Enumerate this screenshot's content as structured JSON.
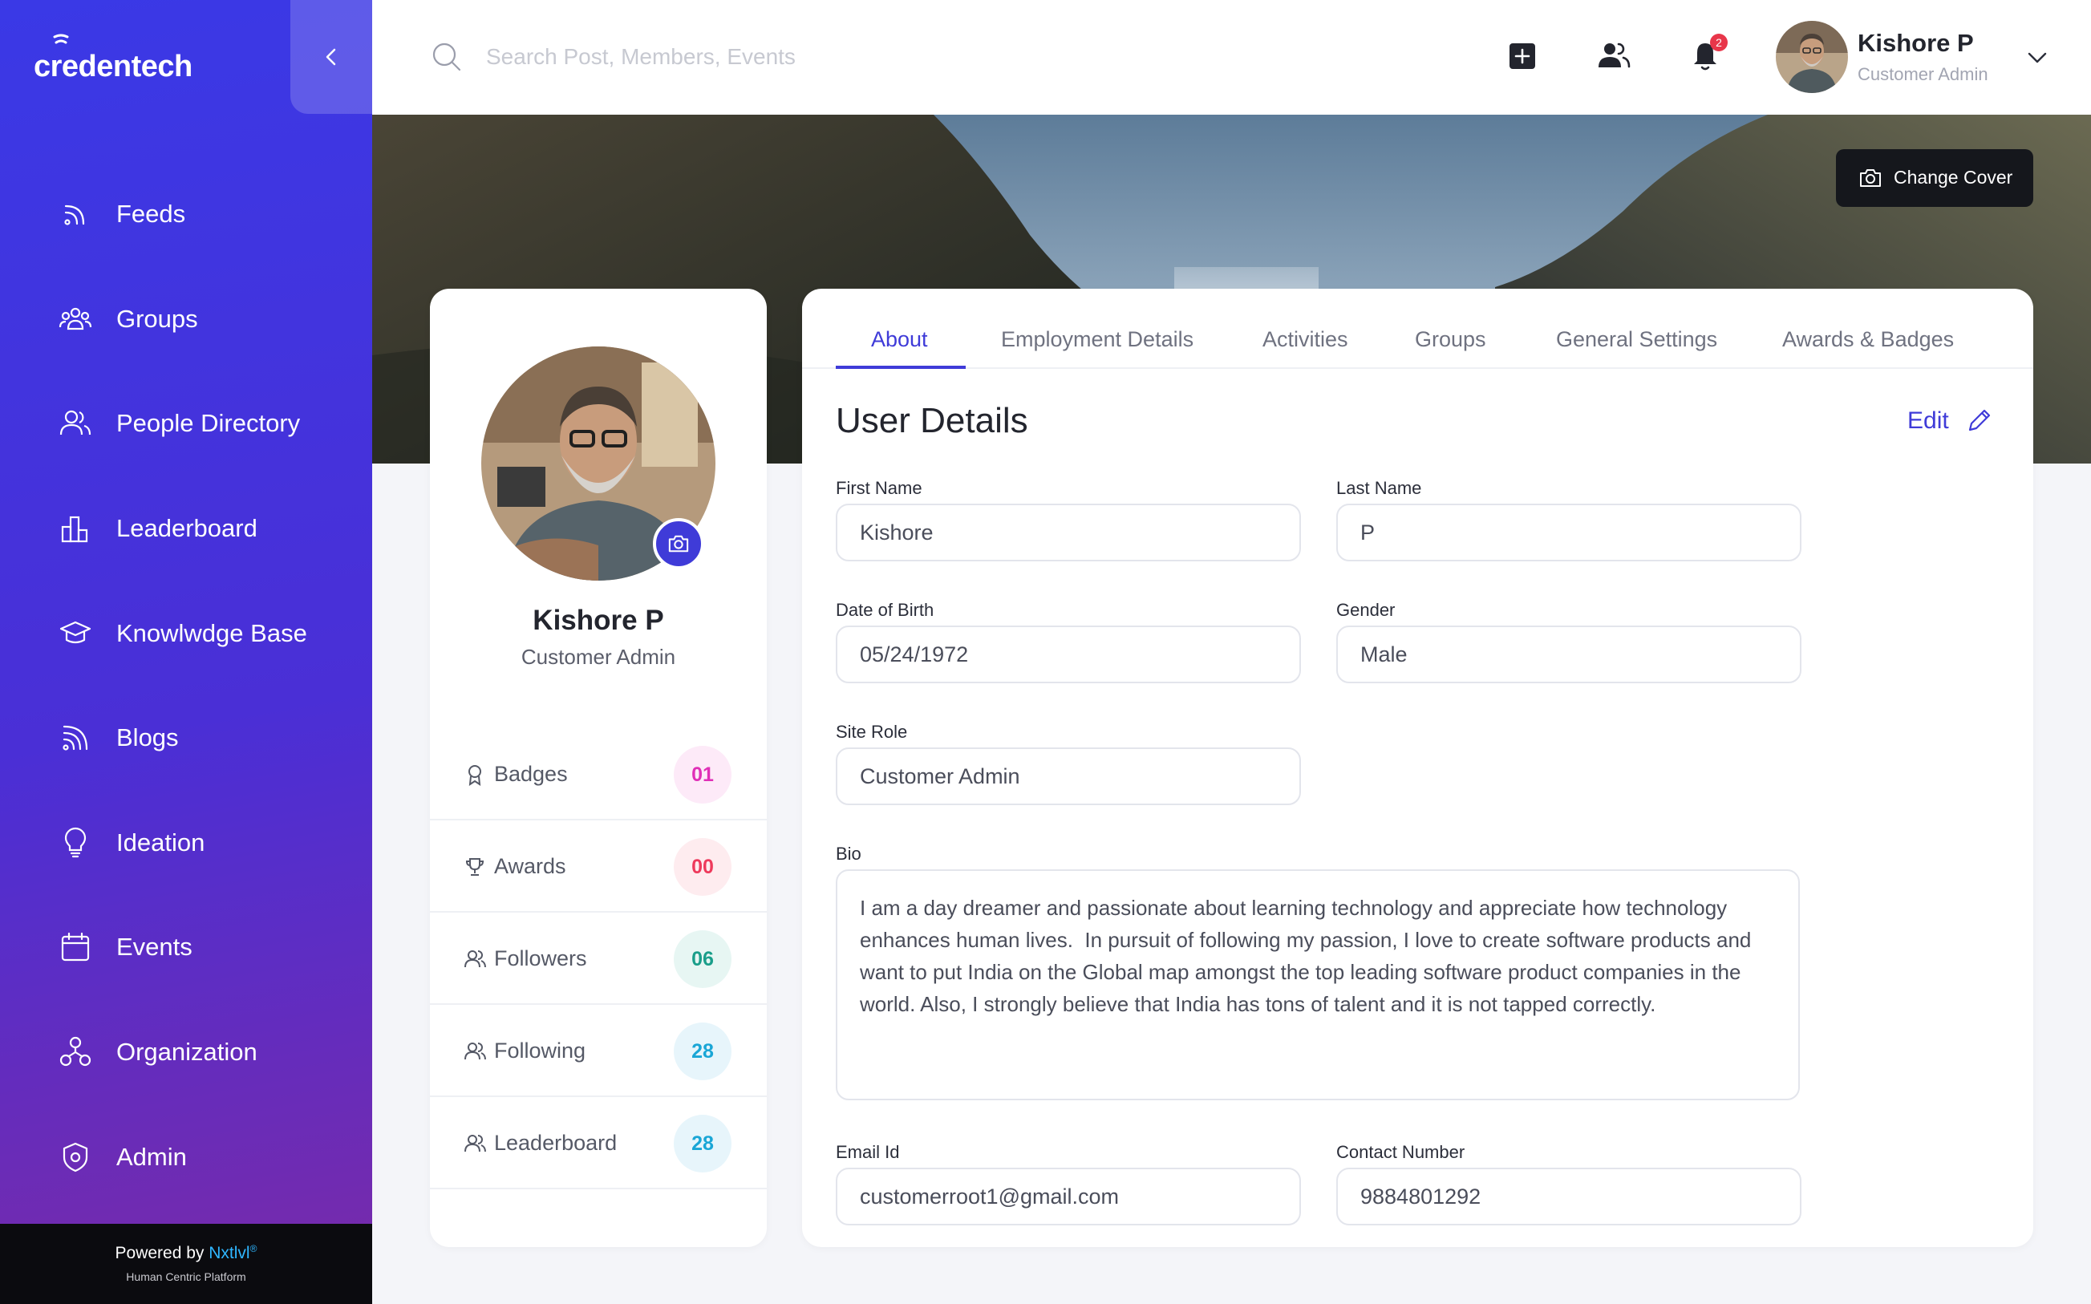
{
  "brand": {
    "logo_text": "credentech",
    "accent": "#3f3bd8"
  },
  "sidebar": {
    "items": [
      {
        "label": "Feeds",
        "icon": "rss-icon"
      },
      {
        "label": "Groups",
        "icon": "group-icon"
      },
      {
        "label": "People Directory",
        "icon": "people-icon"
      },
      {
        "label": "Leaderboard",
        "icon": "leaderboard-icon"
      },
      {
        "label": "Knowlwdge Base",
        "icon": "graduation-cap-icon"
      },
      {
        "label": "Blogs",
        "icon": "blog-icon"
      },
      {
        "label": "Ideation",
        "icon": "lightbulb-icon"
      },
      {
        "label": "Events",
        "icon": "calendar-icon"
      },
      {
        "label": "Organization",
        "icon": "org-chart-icon"
      },
      {
        "label": "Admin",
        "icon": "admin-shield-icon"
      }
    ],
    "powered_prefix": "Powered by ",
    "powered_brand": "Nxtlvl",
    "powered_mark": "®",
    "powered_tagline": "Human Centric Platform"
  },
  "topbar": {
    "search_placeholder": "Search Post, Members, Events",
    "notification_count": "2",
    "user_name": "Kishore P",
    "user_role": "Customer Admin"
  },
  "cover": {
    "change_cover_label": "Change Cover"
  },
  "profile": {
    "name": "Kishore P",
    "role": "Customer Admin",
    "stats": [
      {
        "label": "Badges",
        "value": "01",
        "color": "#e02fb7",
        "bg": "#fdeaf8",
        "icon": "badge-icon"
      },
      {
        "label": "Awards",
        "value": "00",
        "color": "#ee3a5c",
        "bg": "#feecef",
        "icon": "trophy-icon"
      },
      {
        "label": "Followers",
        "value": "06",
        "color": "#1a9e8a",
        "bg": "#e7f6f3",
        "icon": "followers-icon"
      },
      {
        "label": "Following",
        "value": "28",
        "color": "#1aa6d6",
        "bg": "#e7f5fb",
        "icon": "following-icon"
      },
      {
        "label": "Leaderboard",
        "value": "28",
        "color": "#1aa6d6",
        "bg": "#e7f5fb",
        "icon": "leaderboard-users-icon"
      }
    ]
  },
  "tabs": [
    "About",
    "Employment Details",
    "Activities",
    "Groups",
    "General Settings",
    "Awards & Badges"
  ],
  "details": {
    "title": "User Details",
    "edit_label": "Edit",
    "first_name_label": "First Name",
    "first_name": "Kishore",
    "last_name_label": "Last Name",
    "last_name": "P",
    "dob_label": "Date of Birth",
    "dob": "05/24/1972",
    "gender_label": "Gender",
    "gender": "Male",
    "site_role_label": "Site Role",
    "site_role": "Customer Admin",
    "bio_label": "Bio",
    "bio": "I am a day dreamer and passionate about learning technology and appreciate how technology enhances human lives.  In pursuit of following my passion, I love to create software products and want to put India on the Global map amongst the top leading software product companies in the world. Also, I strongly believe that India has tons of talent and it is not tapped correctly.",
    "email_label": "Email Id",
    "email": "customerroot1@gmail.com",
    "contact_label": "Contact Number",
    "contact": "9884801292"
  }
}
